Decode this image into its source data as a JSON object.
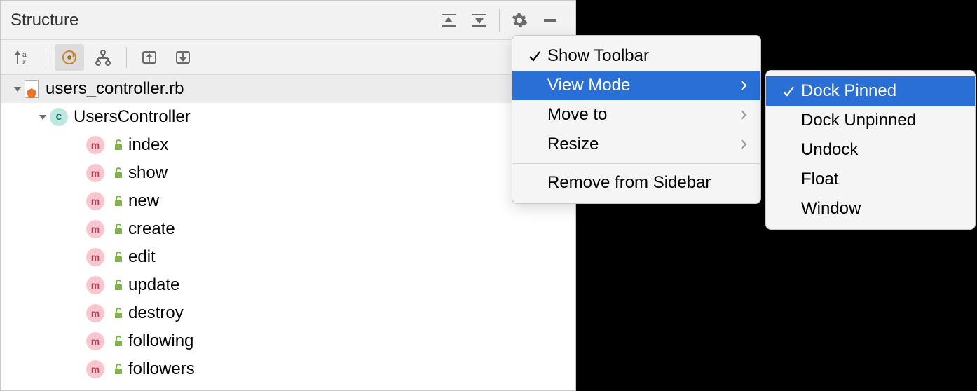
{
  "panel": {
    "title": "Structure",
    "file": "users_controller.rb",
    "class": "UsersController",
    "methods": [
      "index",
      "show",
      "new",
      "create",
      "edit",
      "update",
      "destroy",
      "following",
      "followers"
    ]
  },
  "menu": {
    "show_toolbar": "Show Toolbar",
    "view_mode": "View Mode",
    "move_to": "Move to",
    "resize": "Resize",
    "remove": "Remove from Sidebar"
  },
  "submenu": {
    "dock_pinned": "Dock Pinned",
    "dock_unpinned": "Dock Unpinned",
    "undock": "Undock",
    "float": "Float",
    "window": "Window"
  }
}
